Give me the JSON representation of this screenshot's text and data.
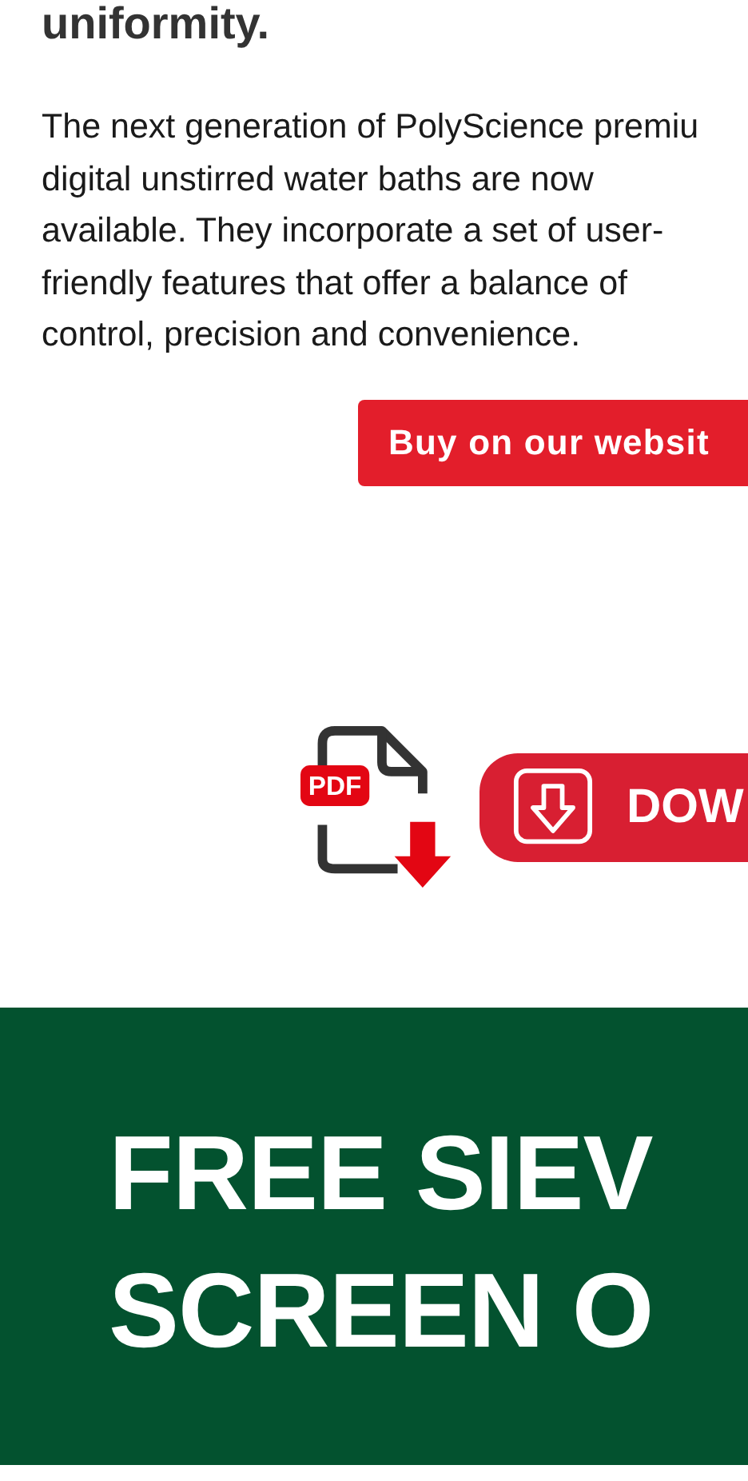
{
  "heading": "uniformity.",
  "paragraph": "The next generation of PolyScience premiu\ndigital unstirred water baths are now\navailable. They incorporate a set of user-\nfriendly features that offer a balance of\ncontrol, precision and convenience.",
  "buy_button": {
    "label": "Buy on our websit"
  },
  "download": {
    "label": "DOW",
    "file_type": "PDF"
  },
  "banner": {
    "lines": [
      "FREE SIEV",
      "SCREEN O"
    ]
  }
}
